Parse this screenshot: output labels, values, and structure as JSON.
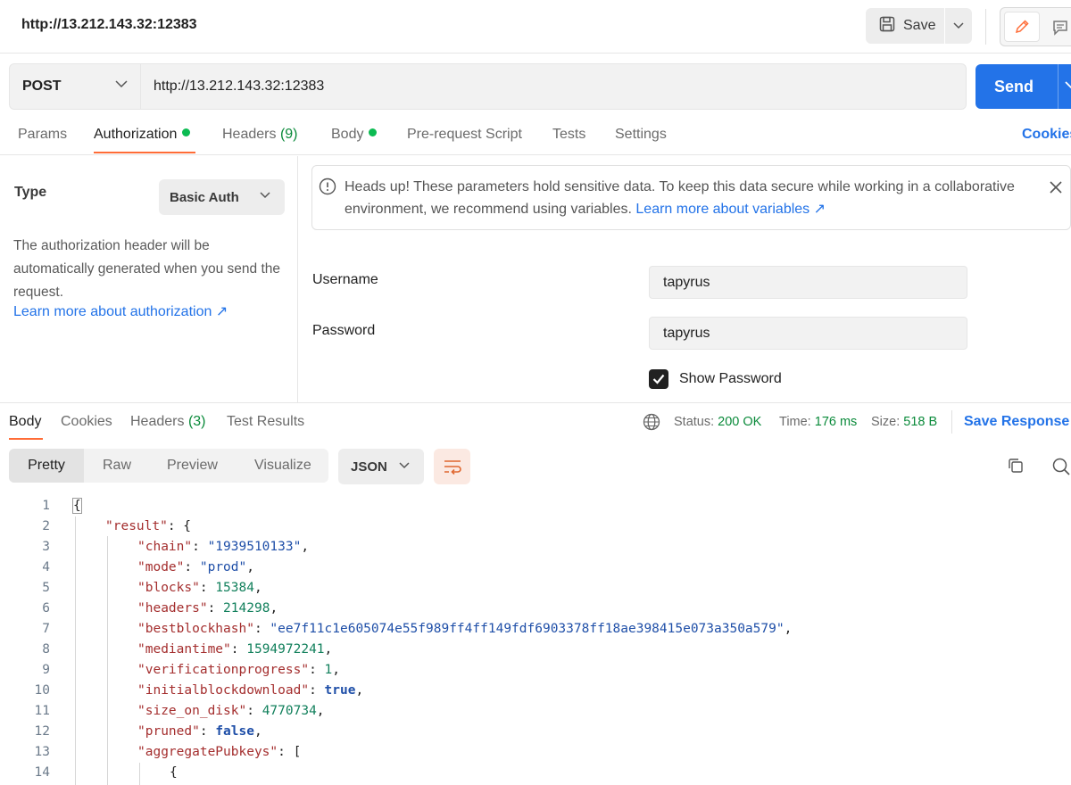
{
  "header": {
    "title": "http://13.212.143.32:12383",
    "save_label": "Save"
  },
  "request": {
    "method": "POST",
    "url": "http://13.212.143.32:12383",
    "send_label": "Send"
  },
  "req_tabs": {
    "params": "Params",
    "authorization": "Authorization",
    "headers": "Headers",
    "headers_count": "(9)",
    "body": "Body",
    "prerequest": "Pre-request Script",
    "tests": "Tests",
    "settings": "Settings",
    "cookies": "Cookies"
  },
  "auth": {
    "type_label": "Type",
    "type_value": "Basic Auth",
    "description": "The authorization header will be automatically generated when you send the request.",
    "learn_more": "Learn more about authorization ↗",
    "banner_text": "Heads up! These parameters hold sensitive data. To keep this data secure while working in a collaborative environment, we recommend using variables.",
    "banner_link": "Learn more about variables ↗",
    "username_label": "Username",
    "username_value": "tapyrus",
    "password_label": "Password",
    "password_value": "tapyrus",
    "show_password": "Show Password"
  },
  "response": {
    "tabs": {
      "body": "Body",
      "cookies": "Cookies",
      "headers": "Headers",
      "headers_count": "(3)",
      "test_results": "Test Results"
    },
    "status_label": "Status:",
    "status_value": "200 OK",
    "time_label": "Time:",
    "time_value": "176 ms",
    "size_label": "Size:",
    "size_value": "518 B",
    "save_response": "Save Response",
    "views": [
      "Pretty",
      "Raw",
      "Preview",
      "Visualize"
    ],
    "format": "JSON"
  },
  "code_lines": [
    {
      "n": "1",
      "t": "{"
    },
    {
      "n": "2",
      "t": "\"result\": {"
    },
    {
      "n": "3",
      "key": "\"chain\"",
      "val": "\"1939510133\"",
      "kind": "s"
    },
    {
      "n": "4",
      "key": "\"mode\"",
      "val": "\"prod\"",
      "kind": "s"
    },
    {
      "n": "5",
      "key": "\"blocks\"",
      "val": "15384",
      "kind": "n"
    },
    {
      "n": "6",
      "key": "\"headers\"",
      "val": "214298",
      "kind": "n"
    },
    {
      "n": "7",
      "key": "\"bestblockhash\"",
      "val": "\"ee7f11c1e605074e55f989ff4ff149fdf6903378ff18ae398415e073a350a579\"",
      "kind": "s"
    },
    {
      "n": "8",
      "key": "\"mediantime\"",
      "val": "1594972241",
      "kind": "n"
    },
    {
      "n": "9",
      "key": "\"verificationprogress\"",
      "val": "1",
      "kind": "n"
    },
    {
      "n": "10",
      "key": "\"initialblockdownload\"",
      "val": "true",
      "kind": "b"
    },
    {
      "n": "11",
      "key": "\"size_on_disk\"",
      "val": "4770734",
      "kind": "n"
    },
    {
      "n": "12",
      "key": "\"pruned\"",
      "val": "false",
      "kind": "b"
    },
    {
      "n": "13",
      "key": "\"aggregatePubkeys\"",
      "val": "[",
      "kind": "p"
    },
    {
      "n": "14",
      "t": "{"
    }
  ],
  "colors": {
    "accent": "#ff6c37",
    "primary": "#2373e8",
    "success": "#0cbb52"
  }
}
